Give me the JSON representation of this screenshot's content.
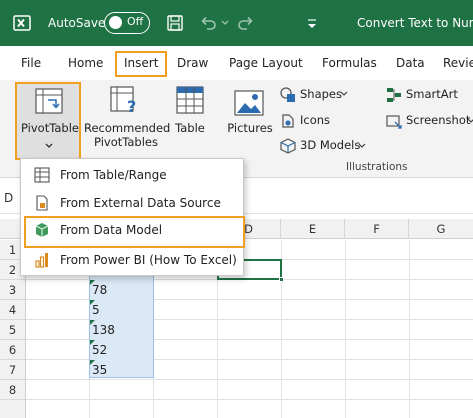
{
  "titlebar": {
    "autosave_label": "AutoSave",
    "autosave_state": "Off",
    "document_title": "Convert Text to Numb"
  },
  "tabs": [
    {
      "label": "File"
    },
    {
      "label": "Home"
    },
    {
      "label": "Insert",
      "selected": true
    },
    {
      "label": "Draw"
    },
    {
      "label": "Page Layout"
    },
    {
      "label": "Formulas"
    },
    {
      "label": "Data"
    },
    {
      "label": "Revie"
    }
  ],
  "ribbon": {
    "pivottable_label": "PivotTable",
    "recommended_line1": "Recommended",
    "recommended_line2": "PivotTables",
    "table_label": "Table",
    "pictures_label": "Pictures",
    "shapes_label": "Shapes",
    "icons_label": "Icons",
    "models_label": "3D Models",
    "smartart_label": "SmartArt",
    "screenshot_label": "Screenshot",
    "group_illustrations": "Illustrations"
  },
  "pivot_menu": {
    "items": [
      {
        "label": "From Table/Range",
        "icon": "table-range-icon"
      },
      {
        "label": "From External Data Source",
        "icon": "external-data-icon"
      },
      {
        "label": "From Data Model",
        "icon": "data-model-icon",
        "highlighted": true
      },
      {
        "label": "From Power BI (How To Excel)",
        "icon": "power-bi-icon"
      }
    ]
  },
  "grid": {
    "name_box_visible_char": "D",
    "columns": [
      "D",
      "E",
      "F",
      "G"
    ],
    "rows": [
      "1",
      "2",
      "3",
      "4",
      "5",
      "6",
      "7",
      "8"
    ],
    "column_b_values": [
      "78",
      "5",
      "138",
      "52",
      "35"
    ]
  },
  "colors": {
    "excel_green": "#1f7244",
    "highlight_orange": "#f0a01e",
    "selection_fill": "#dbe8f6"
  }
}
